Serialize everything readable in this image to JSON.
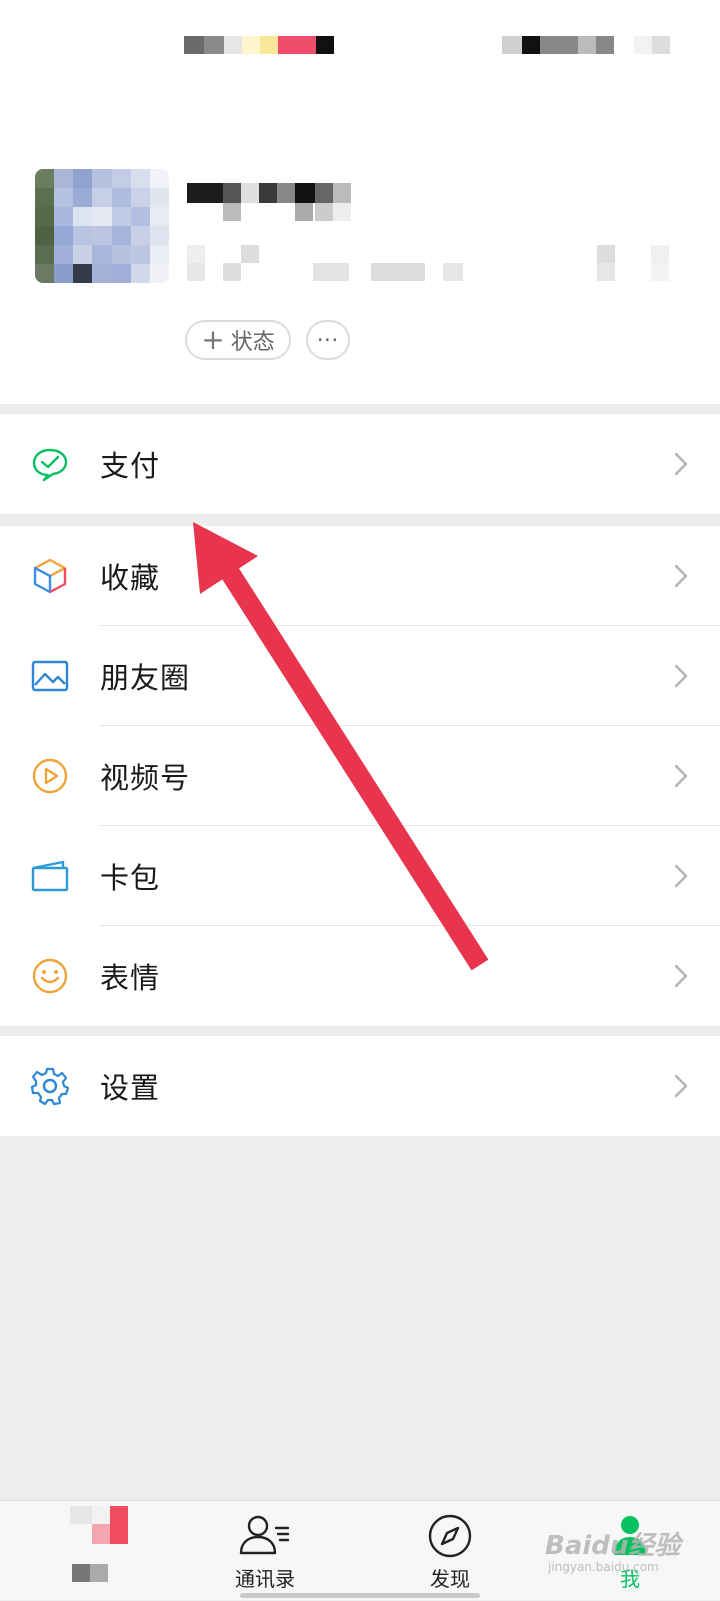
{
  "profile": {
    "status_button_label": "状态",
    "status_button_plus": "+",
    "more_button_label": "···"
  },
  "menu": {
    "pay": {
      "label": "支付",
      "icon": "wechat-pay-icon"
    },
    "items": [
      {
        "label": "收藏",
        "icon": "favorites-cube-icon"
      },
      {
        "label": "朋友圈",
        "icon": "moments-picture-icon"
      },
      {
        "label": "视频号",
        "icon": "channels-play-icon"
      },
      {
        "label": "卡包",
        "icon": "card-wallet-icon"
      },
      {
        "label": "表情",
        "icon": "sticker-smiley-icon"
      }
    ],
    "settings": {
      "label": "设置",
      "icon": "settings-gear-icon"
    }
  },
  "tabbar": {
    "tabs": [
      {
        "label": "",
        "icon": "chats-icon"
      },
      {
        "label": "通讯录",
        "icon": "contacts-icon"
      },
      {
        "label": "发现",
        "icon": "discover-compass-icon"
      },
      {
        "label": "我",
        "icon": "me-person-icon"
      }
    ]
  },
  "watermark": {
    "text": "Baidu经验",
    "sub": "jingyan.baidu.com"
  },
  "colors": {
    "accent_green": "#07c160",
    "arrow_red": "#e8344c",
    "page_bg": "#ededed"
  }
}
